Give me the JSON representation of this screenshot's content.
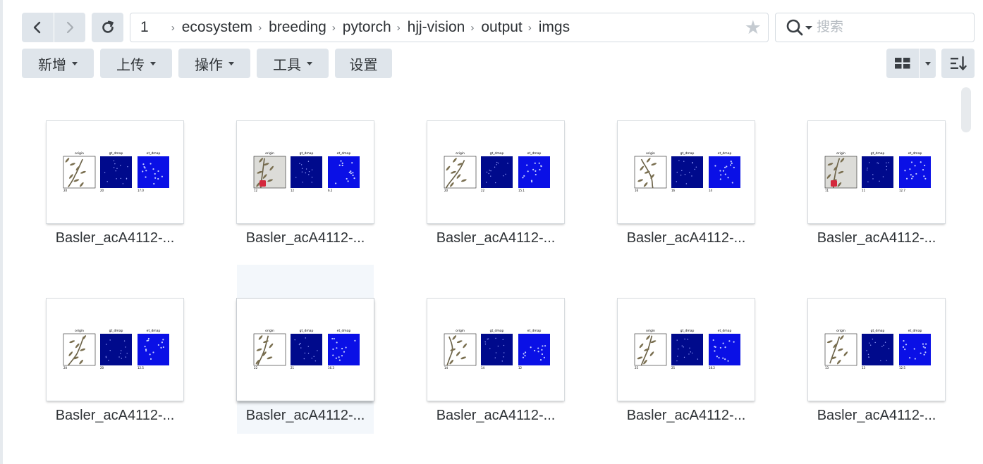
{
  "nav": {
    "back_icon": "chevron-left-icon",
    "forward_icon": "chevron-right-icon",
    "refresh_icon": "refresh-icon"
  },
  "path": {
    "root": "1",
    "segments": [
      "ecosystem",
      "breeding",
      "pytorch",
      "hjj-vision",
      "output",
      "imgs"
    ],
    "favorite_icon": "star-icon"
  },
  "search": {
    "placeholder": "搜索"
  },
  "toolbar": {
    "new_label": "新增",
    "upload_label": "上传",
    "action_label": "操作",
    "tools_label": "工具",
    "settings_label": "设置"
  },
  "view": {
    "mode_icon": "grid-view-icon",
    "sort_icon": "sort-icon"
  },
  "thumbnail_labels": {
    "origin": "origin",
    "gt": "gt_dmap",
    "et": "et_dmap"
  },
  "files": [
    {
      "name": "Basler_acA4112-...",
      "count_origin": "20",
      "count_gt": "20",
      "count_et": "17.0"
    },
    {
      "name": "Basler_acA4112-...",
      "count_origin": "12",
      "count_gt": "12",
      "count_et": "6.2"
    },
    {
      "name": "Basler_acA4112-...",
      "count_origin": "20",
      "count_gt": "22",
      "count_et": "15.1"
    },
    {
      "name": "Basler_acA4112-...",
      "count_origin": "16",
      "count_gt": "16",
      "count_et": "14"
    },
    {
      "name": "Basler_acA4112-...",
      "count_origin": "11",
      "count_gt": "11",
      "count_et": "12.7"
    },
    {
      "name": "Basler_acA4112-...",
      "count_origin": "20",
      "count_gt": "20",
      "count_et": "12.5"
    },
    {
      "name": "Basler_acA4112-...",
      "count_origin": "22",
      "count_gt": "21",
      "count_et": "16.3"
    },
    {
      "name": "Basler_acA4112-...",
      "count_origin": "14",
      "count_gt": "14",
      "count_et": "12"
    },
    {
      "name": "Basler_acA4112-...",
      "count_origin": "25",
      "count_gt": "25",
      "count_et": "18.2"
    },
    {
      "name": "Basler_acA4112-...",
      "count_origin": "13",
      "count_gt": "13",
      "count_et": "12.5"
    }
  ],
  "colors": {
    "button_bg": "#dfe5eb",
    "gt_map": "#000a8c",
    "et_map": "#0a10e6",
    "hover_tile": "#f3f7fb"
  }
}
